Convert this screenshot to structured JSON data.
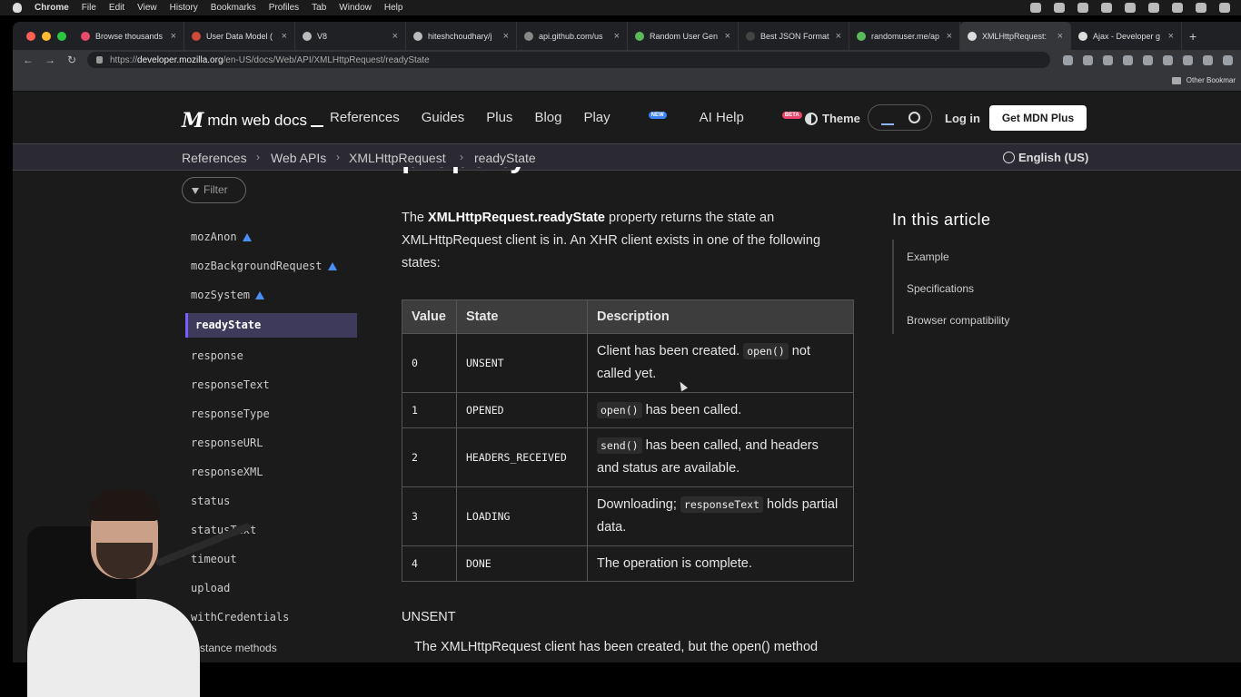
{
  "os_menu": {
    "app": "Chrome",
    "items": [
      "File",
      "Edit",
      "View",
      "History",
      "Bookmarks",
      "Profiles",
      "Tab",
      "Window",
      "Help"
    ]
  },
  "tabs": [
    {
      "title": "Browse thousands",
      "color": "#e84a6a"
    },
    {
      "title": "User Data Model (",
      "color": "#d04a3a"
    },
    {
      "title": "V8",
      "color": "#bbbbbb"
    },
    {
      "title": "hiteshchoudhary/j",
      "color": "#bbbbbb"
    },
    {
      "title": "api.github.com/us",
      "color": "#888888"
    },
    {
      "title": "Random User Gen",
      "color": "#5cb85c"
    },
    {
      "title": "Best JSON Format",
      "color": "#444444"
    },
    {
      "title": "randomuser.me/ap",
      "color": "#5cb85c"
    },
    {
      "title": "XMLHttpRequest:",
      "color": "#dddddd"
    },
    {
      "title": "Ajax - Developer g",
      "color": "#dddddd"
    }
  ],
  "url": {
    "scheme": "https://",
    "host": "developer.mozilla.org",
    "path": "/en-US/docs/Web/API/XMLHttpRequest/readyState"
  },
  "bookmarks": {
    "other": "Other Bookmar"
  },
  "mdn": {
    "logo": "mdn web docs",
    "nav": [
      "References",
      "Guides",
      "Plus",
      "Blog",
      "Play",
      "AI Help"
    ],
    "play_badge": "NEW",
    "ai_badge": "BETA",
    "theme": "Theme",
    "login": "Log in",
    "get_plus": "Get MDN Plus",
    "language": "English (US)"
  },
  "breadcrumbs": [
    "References",
    "Web APIs",
    "XMLHttpRequest",
    "readyState"
  ],
  "sidebar": {
    "filter": "Filter",
    "items": [
      "mozAnon",
      "mozBackgroundRequest",
      "mozSystem",
      "readyState",
      "response",
      "responseText",
      "responseType",
      "responseURL",
      "responseXML",
      "status",
      "statusText",
      "timeout",
      "upload",
      "withCredentials",
      "Instance methods"
    ]
  },
  "page": {
    "title_fragment": "property",
    "intro_bold": "XMLHttpRequest.readyState",
    "intro_pre": "The ",
    "intro_post": " property returns the state an XMLHttpRequest client is in. An XHR client exists in one of the following states:",
    "table": {
      "headers": [
        "Value",
        "State",
        "Description"
      ],
      "rows": [
        {
          "value": "0",
          "state": "UNSENT",
          "desc_pre": "Client has been created. ",
          "code": "open()",
          "desc_post": " not called yet."
        },
        {
          "value": "1",
          "state": "OPENED",
          "desc_pre": "",
          "code": "open()",
          "desc_post": " has been called."
        },
        {
          "value": "2",
          "state": "HEADERS_RECEIVED",
          "desc_pre": "",
          "code": "send()",
          "desc_post": " has been called, and headers and status are available."
        },
        {
          "value": "3",
          "state": "LOADING",
          "desc_pre": "Downloading; ",
          "code": "responseText",
          "desc_post": " holds partial data."
        },
        {
          "value": "4",
          "state": "DONE",
          "desc_pre": "The operation is complete.",
          "code": "",
          "desc_post": ""
        }
      ]
    },
    "sub_heading": "UNSENT",
    "sub_text": "The XMLHttpRequest client has been created, but the open() method"
  },
  "toc": {
    "title": "In this article",
    "items": [
      "Example",
      "Specifications",
      "Browser compatibility"
    ]
  }
}
